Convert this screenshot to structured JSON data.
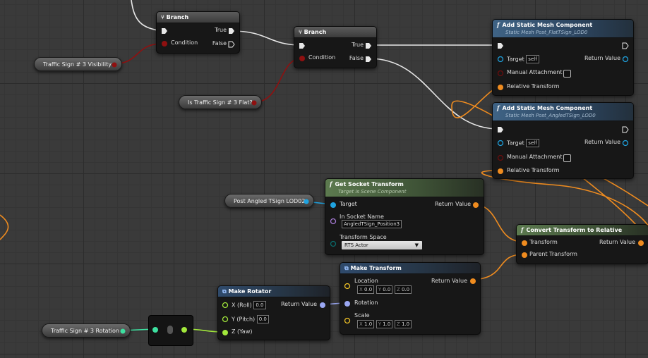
{
  "colors": {
    "exec": "#e8e8e8",
    "bool": "#8f1010",
    "struct_transform": "#f08c1f",
    "object": "#1fa3e0",
    "name": "#a77bd6",
    "byte": "#0a6b6b",
    "vector": "#f1c427",
    "rotator": "#9aa7f2",
    "float": "#a2e83b",
    "float_teal": "#3de0a0"
  },
  "nodes": {
    "branch1": {
      "title": "Branch",
      "condition": "Condition",
      "true_pin": "True",
      "false_pin": "False"
    },
    "branch2": {
      "title": "Branch",
      "condition": "Condition",
      "true_pin": "True",
      "false_pin": "False"
    },
    "add_flat": {
      "title": "Add Static Mesh Component",
      "subtitle": "Static Mesh Post_FlatTSign_LOD0",
      "target": "Target",
      "target_value": "self",
      "return_value": "Return Value",
      "manual_attachment": "Manual Attachment",
      "relative_transform": "Relative Transform"
    },
    "add_angled": {
      "title": "Add Static Mesh Component",
      "subtitle": "Static Mesh Post_AngledTSign_LOD0",
      "target": "Target",
      "target_value": "self",
      "return_value": "Return Value",
      "manual_attachment": "Manual Attachment",
      "relative_transform": "Relative Transform"
    },
    "get_socket": {
      "title": "Get Socket Transform",
      "subtitle": "Target is Scene Component",
      "target": "Target",
      "return_value": "Return Value",
      "socket_name_label": "In Socket Name",
      "socket_name_value": "AngledTSign_Position3",
      "transform_space_label": "Transform Space",
      "transform_space_value": "RTS Actor"
    },
    "convert": {
      "title": "Convert Transform to Relative",
      "transform": "Transform",
      "parent_transform": "Parent Transform",
      "return_value": "Return Value"
    },
    "make_transform": {
      "title": "Make Transform",
      "location": "Location",
      "rotation": "Rotation",
      "scale": "Scale",
      "return_value": "Return Value",
      "loc": {
        "x_label": "X",
        "x": "0.0",
        "y_label": "Y",
        "y": "0.0",
        "z_label": "Z",
        "z": "0.0"
      },
      "scl": {
        "x_label": "X",
        "x": "1.0",
        "y_label": "Y",
        "y": "1.0",
        "z_label": "Z",
        "z": "1.0"
      }
    },
    "make_rotator": {
      "title": "Make Rotator",
      "x_label": "X (Roll)",
      "x_value": "0.0",
      "y_label": "Y (Pitch)",
      "y_value": "0.0",
      "z_label": "Z (Yaw)",
      "return_value": "Return Value"
    }
  },
  "variables": {
    "visibility": "Traffic Sign # 3 Visibility",
    "is_flat": "Is Traffic Sign # 3 Flat?",
    "post_angled": "Post Angled TSign LOD02",
    "rotation": "Traffic Sign # 3 Rotation"
  }
}
